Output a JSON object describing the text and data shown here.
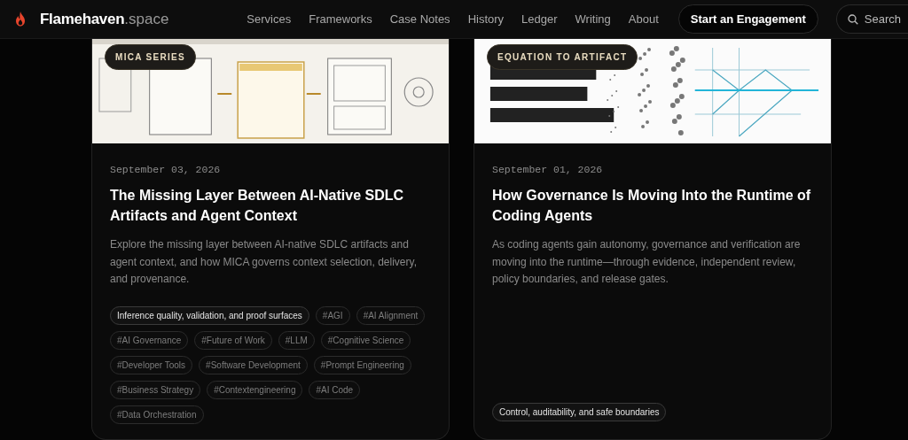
{
  "brand": {
    "name": "Flamehaven",
    "suffix": ".space"
  },
  "nav": [
    {
      "label": "Services"
    },
    {
      "label": "Frameworks"
    },
    {
      "label": "Case Notes"
    },
    {
      "label": "History"
    },
    {
      "label": "Ledger"
    },
    {
      "label": "Writing"
    },
    {
      "label": "About"
    }
  ],
  "cta": "Start an Engagement",
  "search": {
    "label": "Search"
  },
  "posts": [
    {
      "series": "MICA SERIES",
      "date": "September 03, 2026",
      "title": "The Missing Layer Between AI-Native SDLC Artifacts and Agent Context",
      "excerpt": "Explore the missing layer between AI-native SDLC artifacts and agent context, and how MICA governs context selection, delivery, and provenance.",
      "tags": [
        {
          "kind": "pillar",
          "label": "Inference quality, validation, and proof surfaces"
        },
        {
          "kind": "hashtag",
          "label": "#AGI"
        },
        {
          "kind": "hashtag",
          "label": "#AI Alignment"
        },
        {
          "kind": "hashtag",
          "label": "#AI Governance"
        },
        {
          "kind": "hashtag",
          "label": "#Future of Work"
        },
        {
          "kind": "hashtag",
          "label": "#LLM"
        },
        {
          "kind": "hashtag",
          "label": "#Cognitive Science"
        },
        {
          "kind": "hashtag",
          "label": "#Developer Tools"
        },
        {
          "kind": "hashtag",
          "label": "#Software Development"
        },
        {
          "kind": "hashtag",
          "label": "#Prompt Engineering"
        },
        {
          "kind": "hashtag",
          "label": "#Business Strategy"
        },
        {
          "kind": "hashtag",
          "label": "#Contextengineering"
        },
        {
          "kind": "hashtag",
          "label": "#AI Code"
        },
        {
          "kind": "hashtag",
          "label": "#Data Orchestration"
        }
      ]
    },
    {
      "series": "EQUATION TO ARTIFACT",
      "date": "September 01, 2026",
      "title": "How Governance Is Moving Into the Runtime of Coding Agents",
      "excerpt": "As coding agents gain autonomy, governance and verification are moving into the runtime—through evidence, independent review, policy boundaries, and release gates.",
      "tags": [
        {
          "kind": "pillar",
          "label": "Control, auditability, and safe boundaries"
        }
      ]
    }
  ]
}
